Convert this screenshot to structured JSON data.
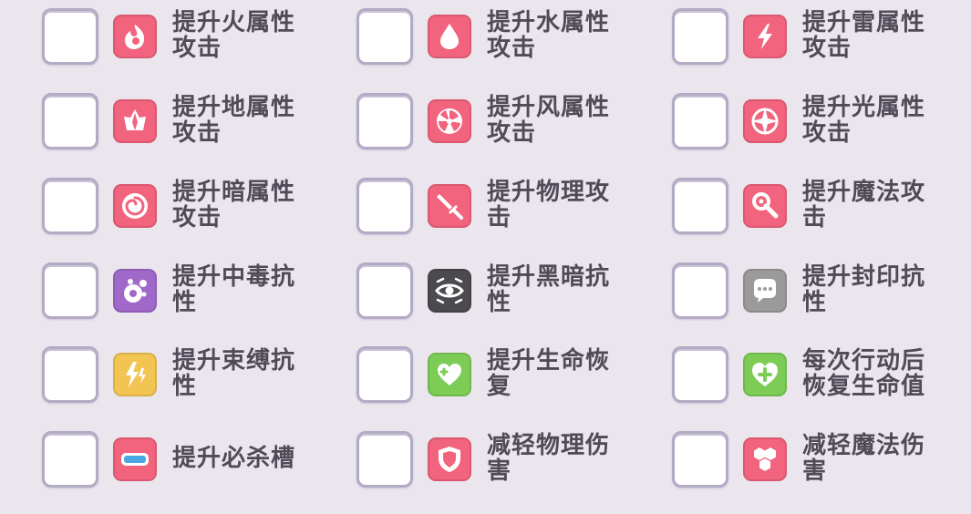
{
  "colors": {
    "background": "#ebe6ee",
    "slot_border": "#b3aac4",
    "text": "#4f4b57",
    "pink": "#f2637d",
    "purple": "#a068c8",
    "dark": "#4a4a4f",
    "gray": "#9a9a9a",
    "yellow": "#f2c452",
    "green": "#7ccc56"
  },
  "items": [
    {
      "label": "提升火属性攻击",
      "icon": "fire-icon",
      "color": "#f2637d"
    },
    {
      "label": "提升水属性攻击",
      "icon": "water-drop-icon",
      "color": "#f2637d"
    },
    {
      "label": "提升雷属性攻击",
      "icon": "lightning-icon",
      "color": "#f2637d"
    },
    {
      "label": "提升地属性攻击",
      "icon": "earth-crystal-icon",
      "color": "#f2637d"
    },
    {
      "label": "提升风属性攻击",
      "icon": "wind-fan-icon",
      "color": "#f2637d"
    },
    {
      "label": "提升光属性攻击",
      "icon": "light-star-icon",
      "color": "#f2637d"
    },
    {
      "label": "提升暗属性攻击",
      "icon": "dark-spiral-icon",
      "color": "#f2637d"
    },
    {
      "label": "提升物理攻击",
      "icon": "sword-icon",
      "color": "#f2637d"
    },
    {
      "label": "提升魔法攻击",
      "icon": "magic-wand-icon",
      "color": "#f2637d"
    },
    {
      "label": "提升中毒抗性",
      "icon": "poison-bubble-icon",
      "color": "#a068c8"
    },
    {
      "label": "提升黑暗抗性",
      "icon": "blind-eye-icon",
      "color": "#4a4a4f"
    },
    {
      "label": "提升封印抗性",
      "icon": "seal-speech-icon",
      "color": "#9a9a9a"
    },
    {
      "label": "提升束缚抗性",
      "icon": "bind-lightning-icon",
      "color": "#f2c452"
    },
    {
      "label": "提升生命恢复",
      "icon": "heart-heal-icon",
      "color": "#7ccc56"
    },
    {
      "label": "每次行动后恢复生命值",
      "icon": "heart-cross-icon",
      "color": "#7ccc56"
    },
    {
      "label": "提升必杀槽",
      "icon": "gauge-bar-icon",
      "color": "#f2637d"
    },
    {
      "label": "减轻物理伤害",
      "icon": "shield-icon",
      "color": "#f2637d"
    },
    {
      "label": "减轻魔法伤害",
      "icon": "magic-hexagon-icon",
      "color": "#f2637d"
    }
  ]
}
